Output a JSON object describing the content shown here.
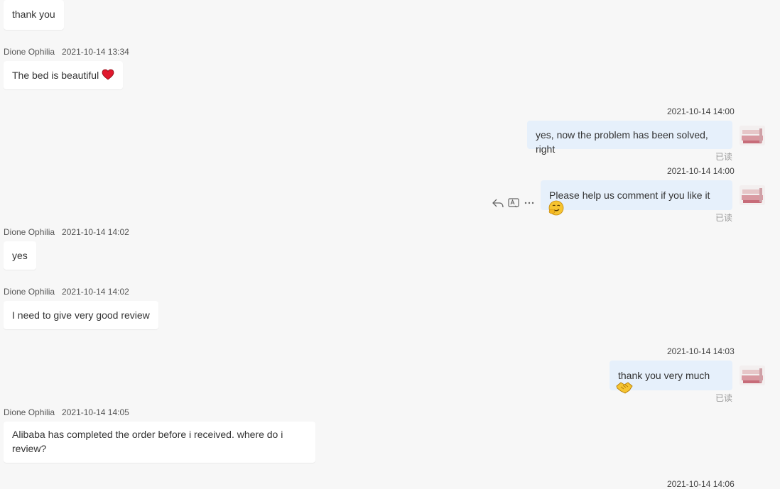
{
  "messages": {
    "m0": {
      "text": "thank you"
    },
    "m1": {
      "sender": "Dione Ophilia",
      "time": "2021-10-14 13:34",
      "text": "The bed is beautiful"
    },
    "m2": {
      "time": "2021-10-14 14:00",
      "text": "yes, now the problem has been solved, right",
      "status": "已读"
    },
    "m3": {
      "time": "2021-10-14 14:00",
      "text": "Please help us comment if you like it",
      "status": "已读"
    },
    "m4": {
      "sender": "Dione Ophilia",
      "time": "2021-10-14 14:02",
      "text": "yes"
    },
    "m5": {
      "sender": "Dione Ophilia",
      "time": "2021-10-14 14:02",
      "text": "I need to give very good review"
    },
    "m6": {
      "time": "2021-10-14 14:03",
      "text": "thank you very much",
      "status": "已读"
    },
    "m7": {
      "sender": "Dione Ophilia",
      "time": "2021-10-14 14:05",
      "text": "Alibaba has completed the order before i received. where do i review?"
    },
    "m8": {
      "time": "2021-10-14 14:06"
    }
  },
  "icons": {
    "heart": "heart-emoji",
    "smirk": "smirk-emoji",
    "handshake": "handshake-emoji",
    "reply": "reply-icon",
    "translate": "translate-icon",
    "more": "more-icon"
  },
  "colors": {
    "incoming_bubble": "#ffffff",
    "outgoing_bubble": "#e6f0fb",
    "background": "#f7f7f7",
    "read_status": "#9a9a9a"
  }
}
